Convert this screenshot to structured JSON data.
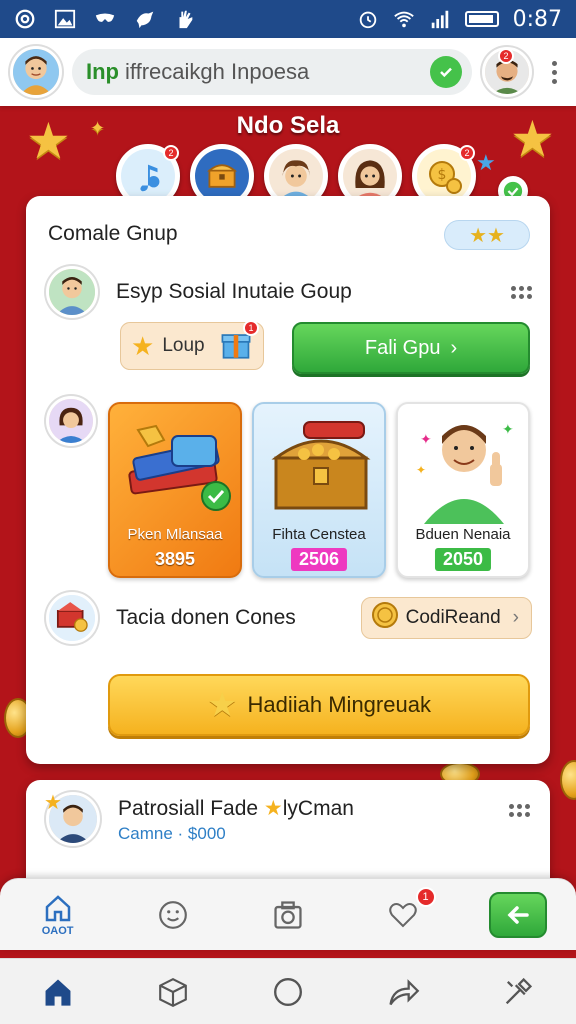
{
  "status_bar": {
    "time": "0:87",
    "icons_left": [
      "at-icon",
      "image-icon",
      "mask-icon",
      "bird-icon",
      "hand-icon"
    ],
    "icons_right": [
      "alarm-icon",
      "wifi-icon",
      "signal-icon",
      "battery-icon"
    ]
  },
  "app_bar": {
    "search_prefix": "Inp",
    "search_text": "iffrecaikgh Inpoesa",
    "profile_badge": "2"
  },
  "banner": {
    "title": "Ndo Sela"
  },
  "stories": [
    {
      "name": "story-music",
      "color": "#5aa7e8",
      "badge": "2"
    },
    {
      "name": "story-chest",
      "color": "#2f6cc0"
    },
    {
      "name": "story-girl",
      "color": "#f3d7b5"
    },
    {
      "name": "story-woman",
      "color": "#f3d7b5"
    },
    {
      "name": "story-coins",
      "color": "#f5c242",
      "badge": "2"
    }
  ],
  "main_card": {
    "title": "Comale Gnup",
    "rating": "★★",
    "group_name": "Esyp Sosial Inutaie Goup",
    "loup_label": "Loup",
    "gift_badge": "1",
    "green_button": "Fali Gpu",
    "tiles": [
      {
        "label": "Pken Mlansaa",
        "value": "3895"
      },
      {
        "label": "Fihta Censtea",
        "value": "2506"
      },
      {
        "label": "Bduen Nenaia",
        "value": "2050"
      }
    ],
    "tacia_label": "Tacia donen Cones",
    "codi_label": "CodiReand",
    "hadiah_button": "Hadiiah Mingreuak"
  },
  "second_card": {
    "name": "Patrosiall Fade",
    "name_suffix": "lyCman",
    "subtitle": "Camne · $000"
  },
  "tab_bar": {
    "home_label": "OAOT",
    "heart_badge": "1"
  },
  "colors": {
    "status_bar": "#1f4a8a",
    "background": "#b3141a",
    "green": "#2fa83a",
    "gold": "#f5b21f"
  }
}
